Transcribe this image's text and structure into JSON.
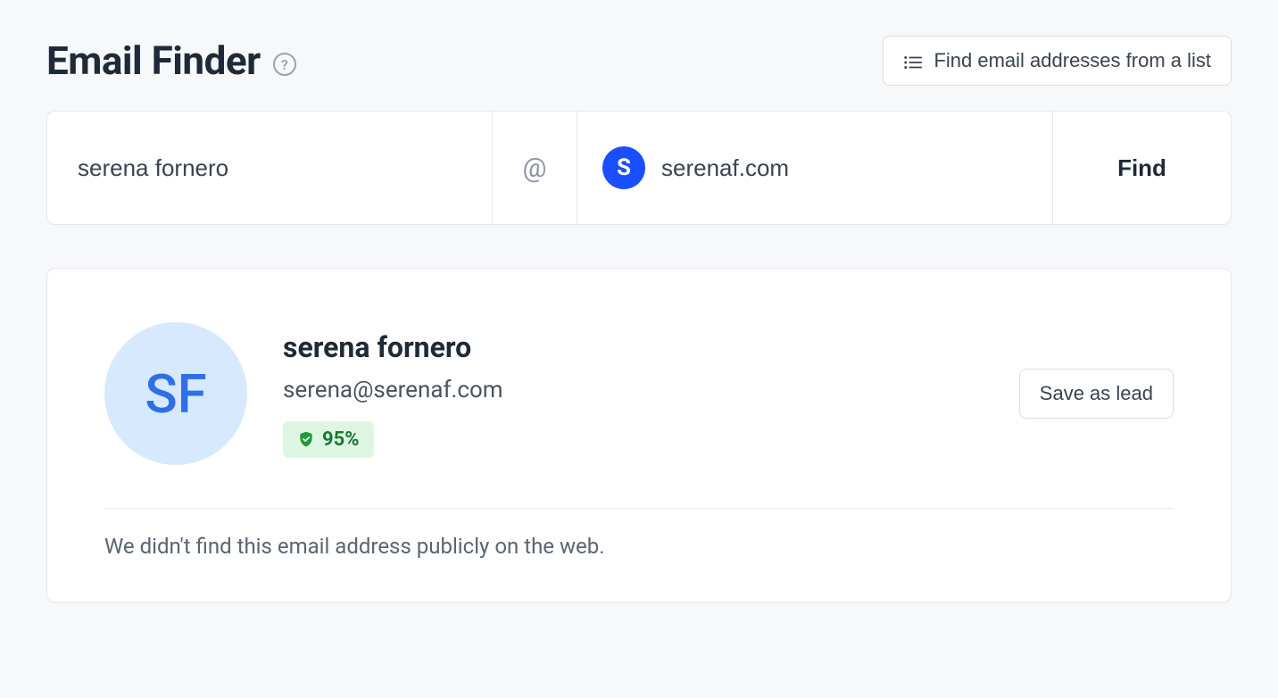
{
  "header": {
    "title": "Email Finder",
    "list_button_label": "Find email addresses from a list"
  },
  "search": {
    "name_value": "serena fornero",
    "at_symbol": "@",
    "domain_value": "serenaf.com",
    "domain_badge_letter": "S",
    "find_button_label": "Find"
  },
  "result": {
    "avatar_initials": "SF",
    "name": "serena fornero",
    "email": "serena@serenaf.com",
    "confidence": "95%",
    "save_button_label": "Save as lead",
    "not_found_message": "We didn't find this email address publicly on the web."
  }
}
